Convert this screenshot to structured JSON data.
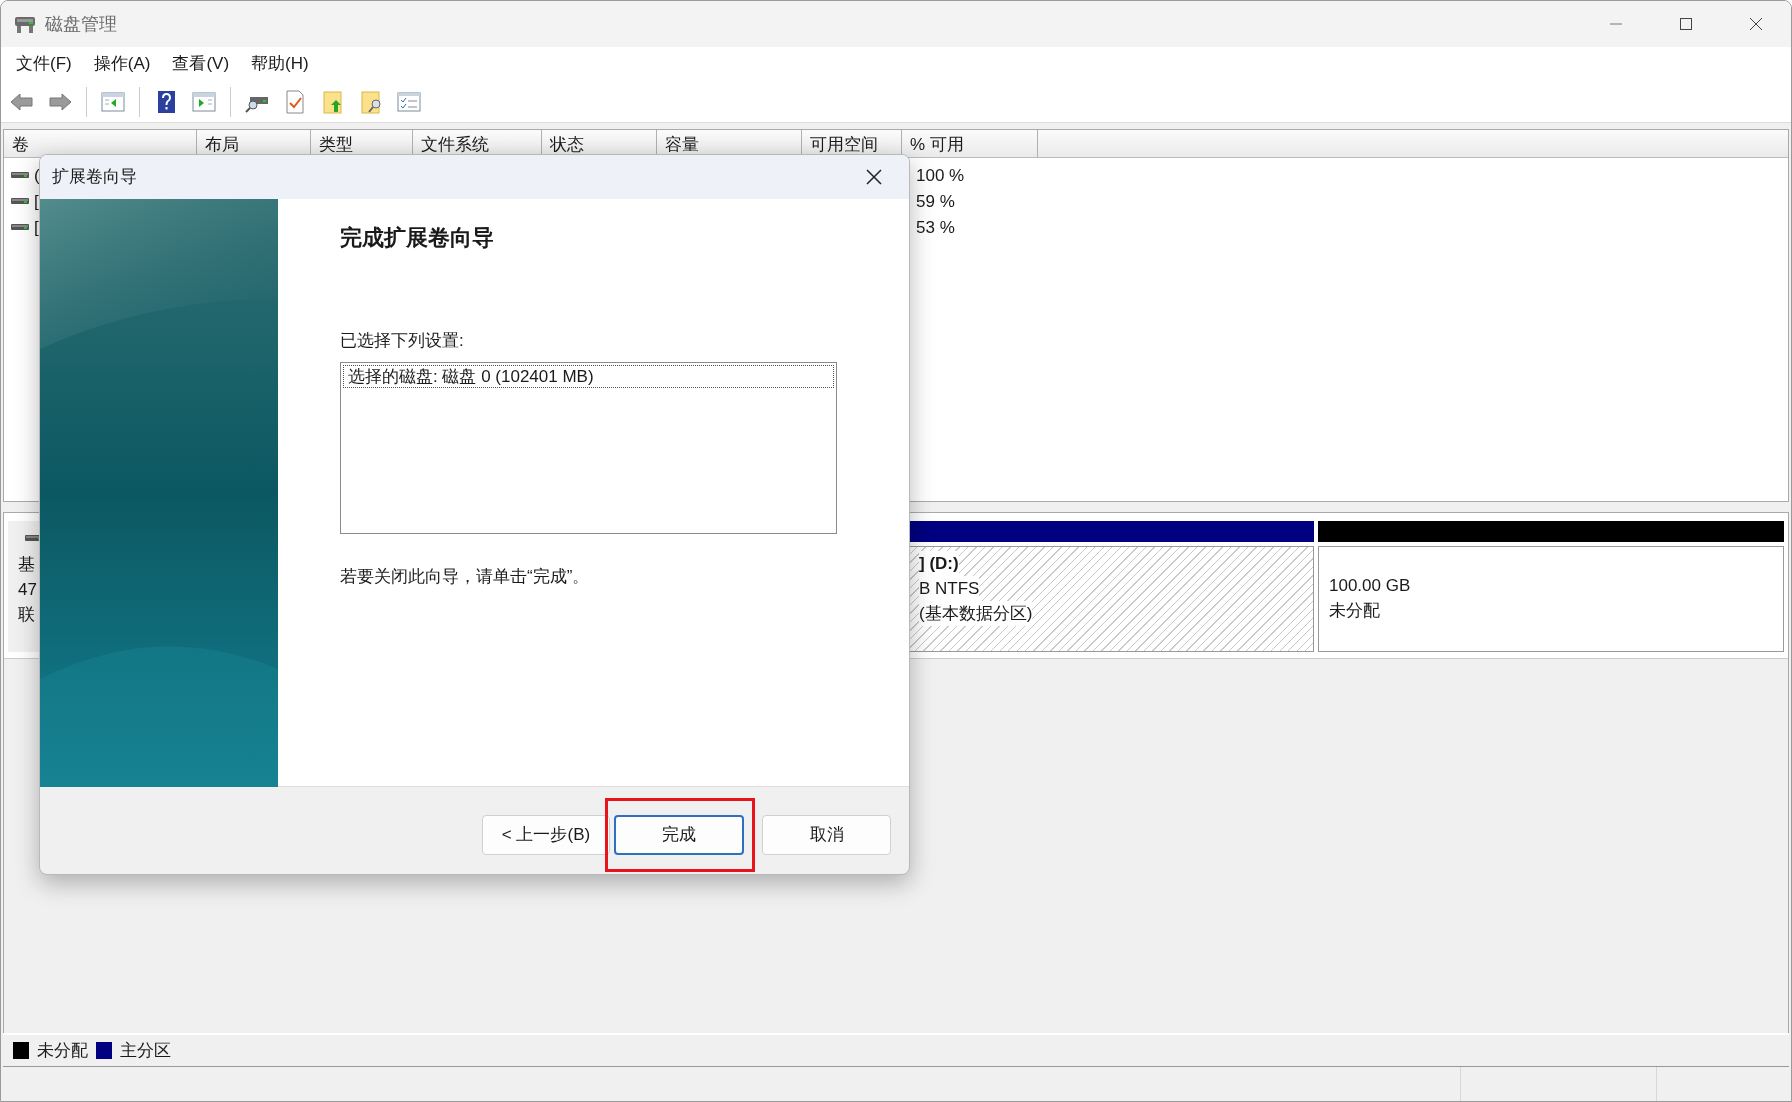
{
  "window": {
    "title": "磁盘管理"
  },
  "menu": [
    {
      "label": "文件(F)"
    },
    {
      "label": "操作(A)"
    },
    {
      "label": "查看(V)"
    },
    {
      "label": "帮助(H)"
    }
  ],
  "volume_table": {
    "columns": [
      "卷",
      "布局",
      "类型",
      "文件系统",
      "状态",
      "容量",
      "可用空间",
      "% 可用"
    ],
    "rows": [
      {
        "volume": "(",
        "percent_free": "100 %"
      },
      {
        "volume": "[",
        "percent_free": "59 %"
      },
      {
        "volume": "[",
        "percent_free": "53 %"
      }
    ]
  },
  "disk": {
    "labels": [
      "基",
      "47",
      "联"
    ],
    "partitions": [
      {
        "kind": "primary",
        "color": "#000080",
        "title": "] (D:)",
        "lines": [
          "B NTFS",
          "(基本数据分区)"
        ]
      },
      {
        "kind": "unallocated",
        "color": "#000000",
        "lines": [
          "100.00 GB",
          "未分配"
        ]
      }
    ]
  },
  "legend": [
    {
      "label": "未分配",
      "color": "#000000"
    },
    {
      "label": "主分区",
      "color": "#000080"
    }
  ],
  "dialog": {
    "title": "扩展卷向导",
    "heading": "完成扩展卷向导",
    "settings_label": "已选择下列设置:",
    "settings": [
      {
        "text": "选择的磁盘: 磁盘 0 (102401 MB)",
        "selected": true
      }
    ],
    "closing_note": "若要关闭此向导，请单击“完成”。",
    "buttons": [
      {
        "label": "< 上一步(B)",
        "default": false,
        "highlighted": false
      },
      {
        "label": "完成",
        "default": true,
        "highlighted": true
      },
      {
        "label": "取消",
        "default": false,
        "highlighted": false
      }
    ]
  }
}
